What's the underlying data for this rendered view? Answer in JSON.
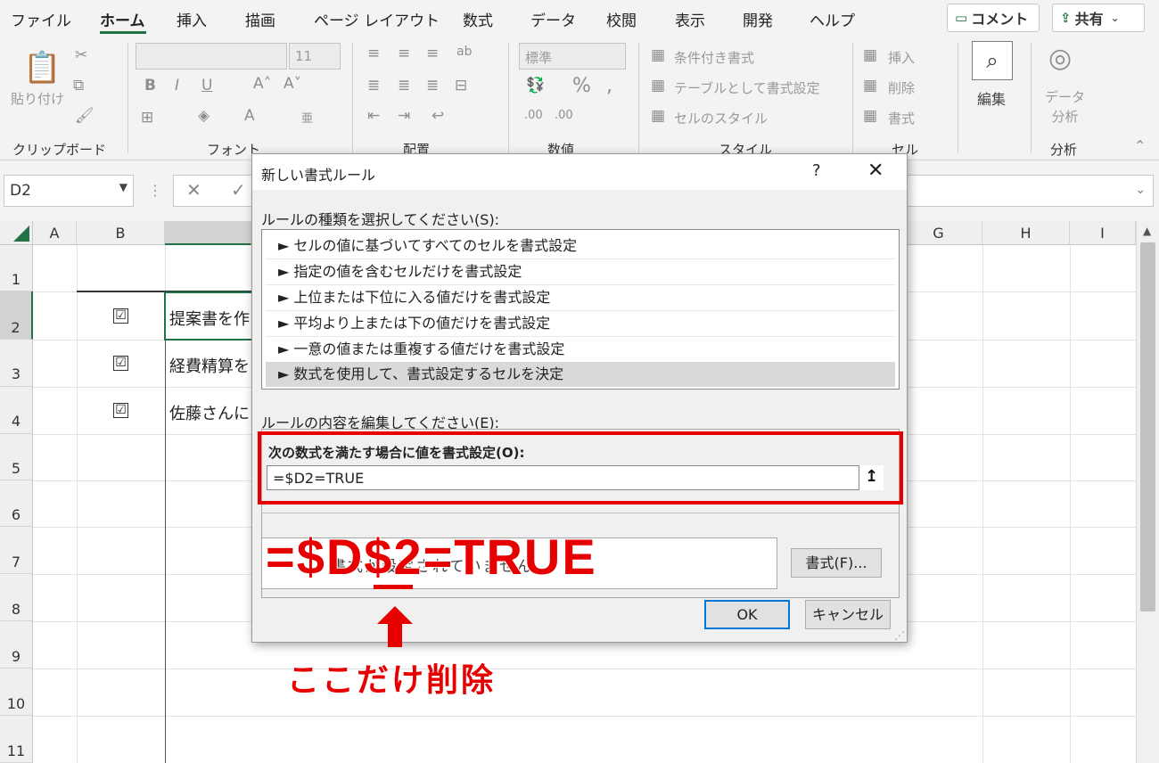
{
  "ribbon_tabs": [
    "ファイル",
    "ホーム",
    "挿入",
    "描画",
    "ページ レイアウト",
    "数式",
    "データ",
    "校閲",
    "表示",
    "開発",
    "ヘルプ"
  ],
  "active_tab": "ホーム",
  "comment_button": "コメント",
  "share_button": "共有",
  "ribbon": {
    "paste": "貼り付け",
    "clipboard_group": "クリップボード",
    "font_group": "フォント",
    "font_size": "11",
    "align_group": "配置",
    "number_group": "数値",
    "number_format": "標準",
    "style_group": "スタイル",
    "conditional_format": "条件付き書式",
    "format_as_table": "テーブルとして書式設定",
    "cell_styles": "セルのスタイル",
    "cells_group": "セル",
    "insert": "挿入",
    "delete": "削除",
    "format": "書式",
    "edit": "編集",
    "data_analysis": "データ\n分析",
    "analysis_group": "分析"
  },
  "name_box": "D2",
  "columns": [
    "A",
    "B",
    "G",
    "H",
    "I"
  ],
  "rows": [
    "1",
    "2",
    "3",
    "4",
    "5",
    "6",
    "7",
    "8",
    "9",
    "10",
    "11"
  ],
  "cells": {
    "c2": "提案書を作",
    "c3": "経費精算を",
    "c4": "佐藤さんに"
  },
  "checkbox_mark": "☑",
  "dialog": {
    "title": "新しい書式ルール",
    "help": "?",
    "close": "✕",
    "rule_type_label": "ルールの種類を選択してください(S):",
    "rule_types": [
      "► セルの値に基づいてすべてのセルを書式設定",
      "► 指定の値を含むセルだけを書式設定",
      "► 上位または下位に入る値だけを書式設定",
      "► 平均より上または下の値だけを書式設定",
      "► 一意の値または重複する値だけを書式設定",
      "► 数式を使用して、書式設定するセルを決定"
    ],
    "selected_rule_index": 5,
    "edit_label": "ルールの内容を編集してください(E):",
    "formula_label": "次の数式を満たす場合に値を書式設定(O):",
    "formula_value": "=$D2=TRUE",
    "preview_text": "書式が設定されていません",
    "format_button": "書式(F)...",
    "ok_button": "OK",
    "cancel_button": "キャンセル"
  },
  "annotation": {
    "big_formula": "=$D$2=TRUE",
    "caption": "ここだけ削除",
    "color": "#e60000"
  }
}
